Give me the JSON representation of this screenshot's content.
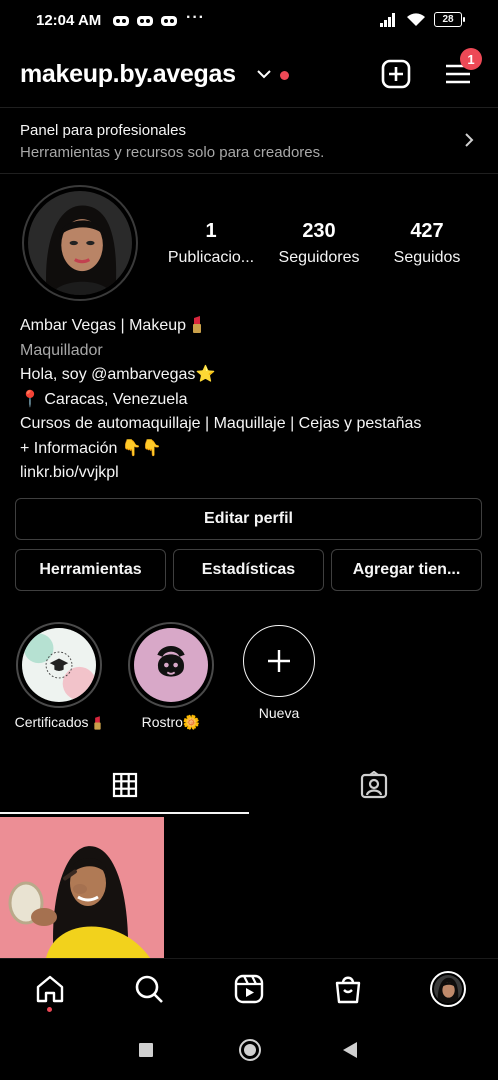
{
  "status_bar": {
    "time": "12:04 AM",
    "dots": "···",
    "battery": "28"
  },
  "header": {
    "username": "makeup.by.avegas",
    "menu_badge": "1"
  },
  "pro_panel": {
    "title": "Panel para profesionales",
    "subtitle": "Herramientas y recursos solo para creadores."
  },
  "stats": [
    {
      "value": "1",
      "label": "Publicacio..."
    },
    {
      "value": "230",
      "label": "Seguidores"
    },
    {
      "value": "427",
      "label": "Seguidos"
    }
  ],
  "bio": {
    "name": "Ambar Vegas | Makeup",
    "category": "Maquillador",
    "line1": "Hola, soy @ambarvegas",
    "line1_emoji": "⭐",
    "line2_emoji": "📍",
    "line2": "Caracas, Venezuela",
    "line3": "Cursos de automaquillaje | Maquillaje | Cejas y pestañas",
    "line4": "+ Información",
    "line4_emoji": "👇👇",
    "link": "linkr.bio/vvjkpl"
  },
  "buttons": {
    "edit_profile": "Editar perfil",
    "tools": "Herramientas",
    "insights": "Estadísticas",
    "add_shop": "Agregar tien..."
  },
  "highlights": [
    {
      "label": "Certificados"
    },
    {
      "label": "Rostro",
      "emoji": "🌼"
    },
    {
      "label": "Nueva"
    }
  ],
  "colors": {
    "accent_red": "#ed4956",
    "background": "#000000",
    "secondary_text": "#a8a8a8",
    "border": "#3f3f3f"
  },
  "icons": {
    "header": [
      "chevron-down-icon",
      "new-post-icon",
      "menu-icon"
    ],
    "tabs": [
      "grid-icon",
      "tagged-icon"
    ],
    "bottom_nav": [
      "home-icon",
      "search-icon",
      "reels-icon",
      "shop-icon",
      "profile-avatar"
    ],
    "system_nav": [
      "recents-icon",
      "home-circle-icon",
      "back-icon"
    ]
  }
}
